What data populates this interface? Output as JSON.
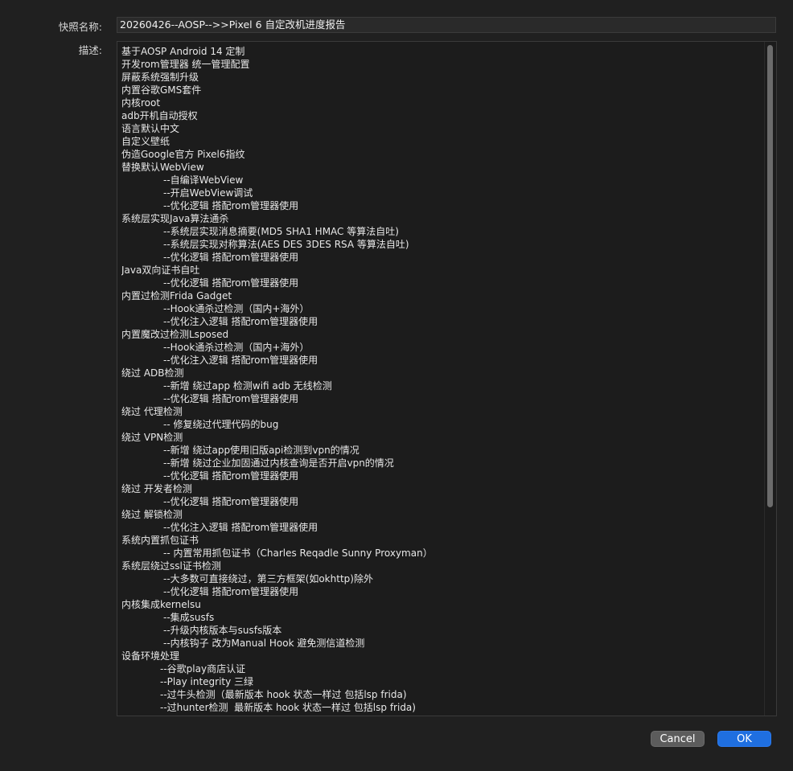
{
  "dialog": {
    "name_label": "快照名称:",
    "name_value": "20260426--AOSP-->>Pixel 6 自定改机进度报告",
    "desc_label": "描述:",
    "cancel_label": "Cancel",
    "ok_label": "OK",
    "accent_color": "#1f6fe0"
  },
  "description": {
    "lines": [
      {
        "text": "基于AOSP Android 14 定制",
        "indent": 0
      },
      {
        "text": "开发rom管理器 统一管理配置",
        "indent": 0
      },
      {
        "text": "屏蔽系统强制升级",
        "indent": 0
      },
      {
        "text": "内置谷歌GMS套件",
        "indent": 0
      },
      {
        "text": "内核root",
        "indent": 0
      },
      {
        "text": "adb开机自动授权",
        "indent": 0
      },
      {
        "text": "语言默认中文",
        "indent": 0
      },
      {
        "text": "自定义壁纸",
        "indent": 0
      },
      {
        "text": "伪造Google官方 Pixel6指纹",
        "indent": 0
      },
      {
        "text": "替换默认WebView",
        "indent": 0
      },
      {
        "text": "--自编译WebView",
        "indent": 1
      },
      {
        "text": "--开启WebView调试",
        "indent": 1
      },
      {
        "text": "--优化逻辑 搭配rom管理器使用",
        "indent": 1
      },
      {
        "text": "系统层实现Java算法通杀",
        "indent": 0
      },
      {
        "text": "--系统层实现消息摘要(MD5 SHA1 HMAC 等算法自吐)",
        "indent": 1
      },
      {
        "text": "--系统层实现对称算法(AES DES 3DES RSA 等算法自吐)",
        "indent": 1
      },
      {
        "text": "--优化逻辑 搭配rom管理器使用",
        "indent": 1
      },
      {
        "text": "Java双向证书自吐",
        "indent": 0
      },
      {
        "text": "--优化逻辑 搭配rom管理器使用",
        "indent": 1
      },
      {
        "text": "内置过检测Frida Gadget",
        "indent": 0
      },
      {
        "text": "--Hook通杀过检测（国内+海外）",
        "indent": 1
      },
      {
        "text": "--优化注入逻辑 搭配rom管理器使用",
        "indent": 1
      },
      {
        "text": "内置魔改过检测Lsposed",
        "indent": 0
      },
      {
        "text": "--Hook通杀过检测（国内+海外）",
        "indent": 1
      },
      {
        "text": "--优化注入逻辑 搭配rom管理器使用",
        "indent": 1
      },
      {
        "text": "绕过 ADB检测",
        "indent": 0
      },
      {
        "text": "--新增 绕过app 检测wifi adb 无线检测",
        "indent": 1
      },
      {
        "text": "--优化逻辑 搭配rom管理器使用",
        "indent": 1
      },
      {
        "text": "绕过 代理检测",
        "indent": 0
      },
      {
        "text": "-- 修复绕过代理代码的bug",
        "indent": 1
      },
      {
        "text": "绕过 VPN检测",
        "indent": 0
      },
      {
        "text": "--新增 绕过app使用旧版api检测到vpn的情况",
        "indent": 1
      },
      {
        "text": "--新增 绕过企业加固通过内核查询是否开启vpn的情况",
        "indent": 1
      },
      {
        "text": "--优化逻辑 搭配rom管理器使用",
        "indent": 1
      },
      {
        "text": "绕过 开发者检测",
        "indent": 0
      },
      {
        "text": "--优化逻辑 搭配rom管理器使用",
        "indent": 1
      },
      {
        "text": "绕过 解锁检测",
        "indent": 0
      },
      {
        "text": "--优化注入逻辑 搭配rom管理器使用",
        "indent": 1
      },
      {
        "text": "系统内置抓包证书",
        "indent": 0
      },
      {
        "text": "-- 内置常用抓包证书（Charles Reqadle Sunny Proxyman）",
        "indent": 1
      },
      {
        "text": "系统层绕过ssl证书检测",
        "indent": 0
      },
      {
        "text": "--大多数可直接绕过，第三方框架(如okhttp)除外",
        "indent": 1
      },
      {
        "text": "--优化逻辑 搭配rom管理器使用",
        "indent": 1
      },
      {
        "text": "内核集成kernelsu",
        "indent": 0
      },
      {
        "text": "--集成susfs",
        "indent": 1
      },
      {
        "text": "--升级内核版本与susfs版本",
        "indent": 1
      },
      {
        "text": "--内核钩子 改为Manual Hook 避免测信道检测",
        "indent": 1
      },
      {
        "text": "设备环境处理",
        "indent": 0
      },
      {
        "text": "--谷歌play商店认证",
        "indent": 2
      },
      {
        "text": "--Play integrity 三绿",
        "indent": 2
      },
      {
        "text": "--过牛头检测（最新版本 hook 状态一样过 包括lsp frida)",
        "indent": 2
      },
      {
        "text": "--过hunter检测  最新版本 hook 状态一样过 包括lsp frida)",
        "indent": 2
      }
    ]
  }
}
